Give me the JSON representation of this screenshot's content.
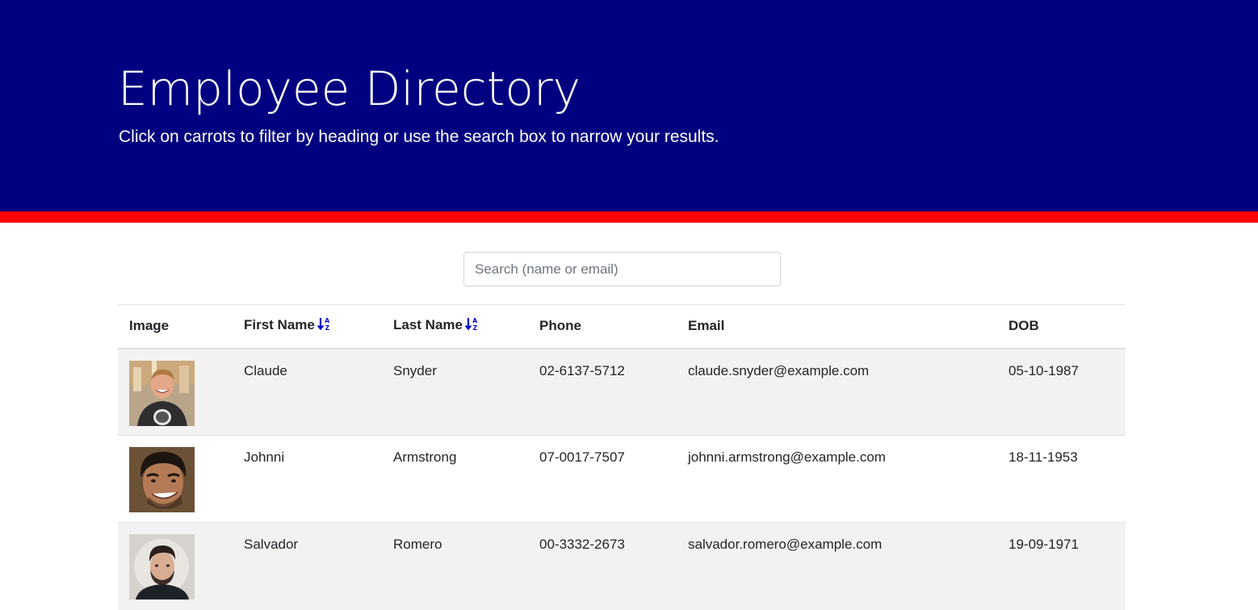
{
  "header": {
    "title": "Employee Directory",
    "subtitle": "Click on carrots to filter by heading or use the search box to narrow your results."
  },
  "colors": {
    "hero_bg": "#000080",
    "hero_rule": "#ff0000",
    "sort_icon": "#0000cc",
    "row_stripe": "#f2f2f2"
  },
  "search": {
    "placeholder": "Search (name or email)",
    "value": ""
  },
  "table": {
    "columns": [
      "Image",
      "First Name",
      "Last Name",
      "Phone",
      "Email",
      "DOB"
    ],
    "sort_icon": "sort-alpha-down-icon",
    "rows": [
      {
        "first": "Claude",
        "last": "Snyder",
        "phone": "02-6137-5712",
        "email": "claude.snyder@example.com",
        "dob": "05-10-1987",
        "avatar": "avatar-man-smiling-black-shirt"
      },
      {
        "first": "Johnni",
        "last": "Armstrong",
        "phone": "07-0017-7507",
        "email": "johnni.armstrong@example.com",
        "dob": "18-11-1953",
        "avatar": "avatar-man-dark-hair-smiling"
      },
      {
        "first": "Salvador",
        "last": "Romero",
        "phone": "00-3332-2673",
        "email": "salvador.romero@example.com",
        "dob": "19-09-1971",
        "avatar": "avatar-man-beard-dark-hair"
      }
    ]
  }
}
